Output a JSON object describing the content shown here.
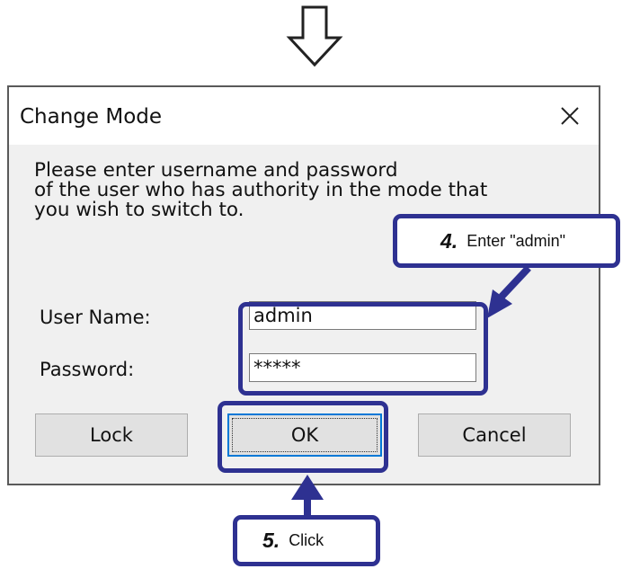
{
  "dialog": {
    "title": "Change Mode",
    "message": "Please enter username and password\nof the user who has authority in the mode that\nyou wish to switch to.",
    "user_name_label": "User Name:",
    "password_label": "Password:",
    "user_name_value": "admin",
    "password_value": "*****",
    "buttons": {
      "lock": "Lock",
      "ok": "OK",
      "cancel": "Cancel"
    },
    "close_icon": "close-icon"
  },
  "annotations": {
    "step4": {
      "number": "4.",
      "text": "Enter \"admin\""
    },
    "step5": {
      "number": "5.",
      "text": "Click"
    }
  },
  "colors": {
    "highlight": "#2e3191",
    "dialog_bg": "#f0f0f0",
    "ok_focus_border": "#0078d7"
  }
}
